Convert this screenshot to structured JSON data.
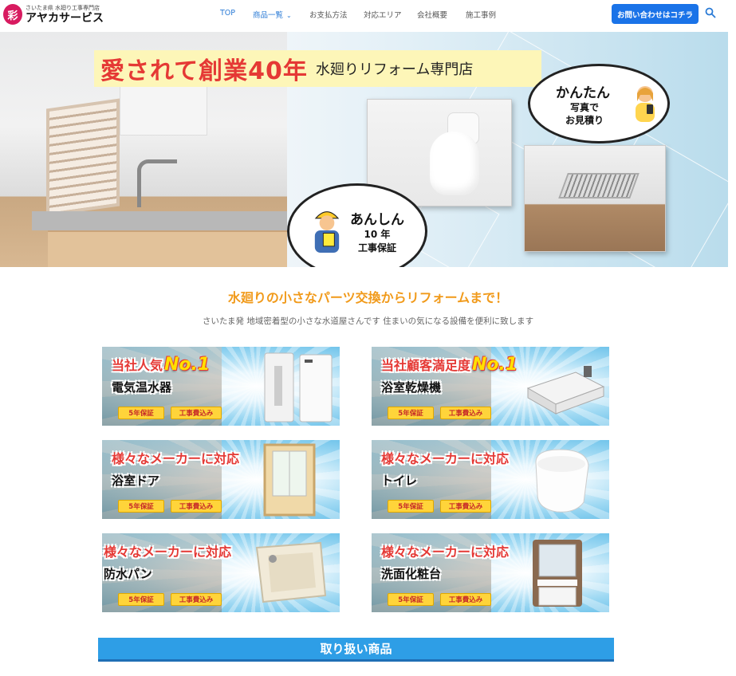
{
  "header": {
    "logo_mark": "彩",
    "logo_tagline": "さいたま県 水廻り工事専門店",
    "logo_name": "アヤカサービス",
    "nav": [
      "TOP",
      "商品一覧",
      "お支払方法",
      "対応エリア",
      "会社概要",
      "施工事例"
    ],
    "cta_label": "お問い合わせはコチラ",
    "icons": {
      "search": "search-icon",
      "chevron": "chevron-down-icon"
    }
  },
  "hero": {
    "banner_main": "愛されて創業40年",
    "banner_sub": "水廻りリフォーム専門店",
    "bubble_easy": {
      "title": "かんたん",
      "line1": "写真で",
      "line2": "お見積り"
    },
    "bubble_safe": {
      "title": "あんしん",
      "line1": "10 年",
      "line2": "工事保証"
    }
  },
  "intro": {
    "subtitle": "水廻りの小さなパーツ交換からリフォームまで！",
    "lead": "さいたま発 地域密着型の小さな水道屋さんです 住まいの気になる設備を便利に致します"
  },
  "cards": [
    {
      "head": "当社人気",
      "badge": "No.1",
      "name": "電気温水器",
      "tag1": "5年保証",
      "tag2": "工事費込み"
    },
    {
      "head": "当社顧客満足度",
      "badge": "No.1",
      "name": "浴室乾燥機",
      "tag1": "5年保証",
      "tag2": "工事費込み"
    },
    {
      "head": "様々なメーカーに対応",
      "badge": "",
      "name": "浴室ドア",
      "tag1": "5年保証",
      "tag2": "工事費込み"
    },
    {
      "head": "様々なメーカーに対応",
      "badge": "",
      "name": "トイレ",
      "tag1": "5年保証",
      "tag2": "工事費込み"
    },
    {
      "head": "様々なメーカーに対応",
      "badge": "",
      "name": "防水パン",
      "tag1": "5年保証",
      "tag2": "工事費込み"
    },
    {
      "head": "様々なメーカーに対応",
      "badge": "",
      "name": "洗面化粧台",
      "tag1": "5年保証",
      "tag2": "工事費込み"
    }
  ],
  "section": {
    "title": "取り扱い商品"
  },
  "colors": {
    "accent_blue": "#1a73e8",
    "nav_blue": "#2b7bd6",
    "orange": "#f19a1a",
    "red": "#e53935",
    "tag_yellow": "#ffd43a"
  }
}
